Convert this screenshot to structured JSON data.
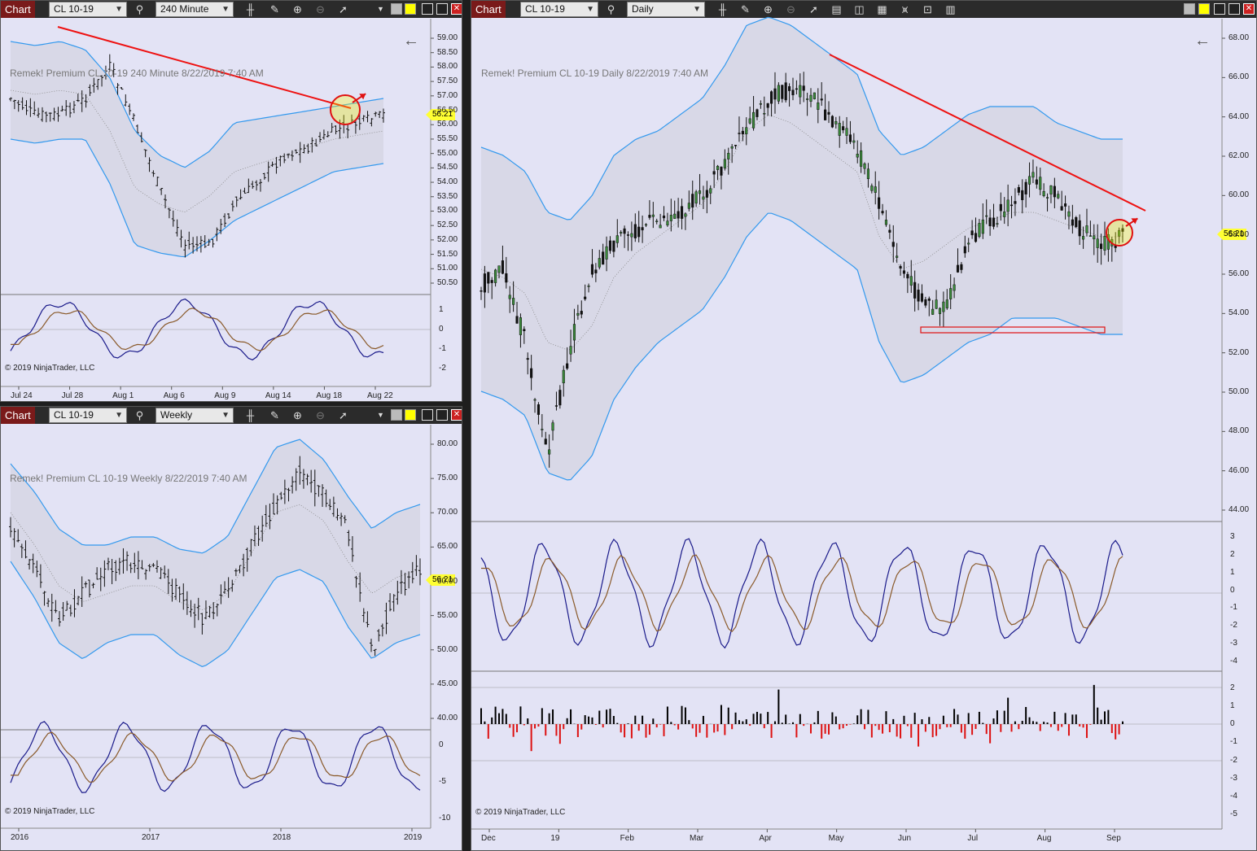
{
  "colors": {
    "bg": "#e3e3f5",
    "toolbar": "#2b2b2b",
    "chart_tab": "#7a1a1a",
    "price_tag": "#ffff33",
    "trendline": "#ee1111",
    "band": "#3399ee",
    "macd": "#1a1a8a",
    "signal": "#8a5a2a",
    "hist_up": "#000000",
    "hist_down": "#dd1111"
  },
  "icons": [
    "search-icon",
    "bars-icon",
    "pencil-icon",
    "zoom-in-icon",
    "zoom-out-icon",
    "pointer-icon",
    "properties-icon",
    "data-box-icon",
    "strategy-icon",
    "indicator-icon",
    "share-icon",
    "dropdown-icon",
    "back-arrow-icon",
    "color-box-icon",
    "maximize-icon",
    "restore-icon",
    "close-icon"
  ],
  "left_top": {
    "tab": "Chart",
    "instrument": "CL 10-19",
    "interval": "240 Minute",
    "label": "Remek!  Premium  CL 10-19  240 Minute  8/22/2019 7:40 AM",
    "price": "56.21",
    "copyright": "© 2019 NinjaTrader, LLC",
    "price_axis": [
      "59.00",
      "58.50",
      "58.00",
      "57.50",
      "57.00",
      "56.50",
      "56.00",
      "55.50",
      "55.00",
      "54.50",
      "54.00",
      "53.50",
      "53.00",
      "52.50",
      "52.00",
      "51.50",
      "51.00",
      "50.50"
    ],
    "osc_axis": [
      "1",
      "0",
      "-1",
      "-2"
    ],
    "dates": [
      "Jul 24",
      "Jul 28",
      "Aug 1",
      "Aug 6",
      "Aug 9",
      "Aug 14",
      "Aug 18",
      "Aug 22"
    ]
  },
  "left_bottom": {
    "tab": "Chart",
    "instrument": "CL 10-19",
    "interval": "Weekly",
    "label": "Remek!  Premium  CL 10-19  Weekly  8/22/2019 7:40 AM",
    "price": "56.21",
    "copyright": "© 2019 NinjaTrader, LLC",
    "price_axis": [
      "80.00",
      "75.00",
      "70.00",
      "65.00",
      "60.00",
      "55.00",
      "50.00",
      "45.00",
      "40.00"
    ],
    "osc_axis": [
      "0",
      "-5",
      "-10"
    ],
    "dates": [
      "2016",
      "2017",
      "2018",
      "2019"
    ]
  },
  "right": {
    "tab": "Chart",
    "instrument": "CL 10-19",
    "interval": "Daily",
    "label": "Remek!  Premium  CL 10-19  Daily  8/22/2019 7:40 AM",
    "price": "56.21",
    "copyright": "© 2019 NinjaTrader, LLC",
    "price_axis": [
      "68.00",
      "66.00",
      "64.00",
      "62.00",
      "60.00",
      "58.00",
      "56.00",
      "54.00",
      "52.00",
      "50.00",
      "48.00",
      "46.00",
      "44.00"
    ],
    "osc_axis": [
      "3",
      "2",
      "1",
      "0",
      "-1",
      "-2",
      "-3",
      "-4"
    ],
    "hist_axis": [
      "2",
      "1",
      "0",
      "-1",
      "-2",
      "-3",
      "-4",
      "-5"
    ],
    "dates": [
      "Dec",
      "19",
      "Feb",
      "Mar",
      "Apr",
      "May",
      "Jun",
      "Jul",
      "Aug",
      "Sep"
    ]
  }
}
